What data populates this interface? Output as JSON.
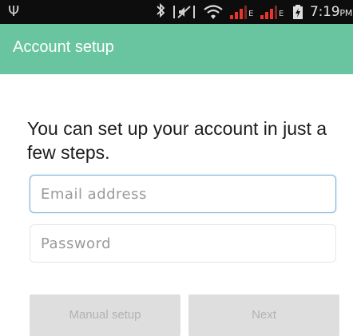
{
  "status_bar": {
    "usb_glyph": "Ψ",
    "bluetooth_glyph": "∦",
    "network_type_1": "E",
    "network_type_2": "E",
    "time": "7:19",
    "am_pm": "PM",
    "signal_color": "#e8362a",
    "icons": [
      "usb-icon",
      "bluetooth-icon",
      "mute-icon",
      "wifi-icon",
      "signal-icon",
      "signal-icon",
      "battery-icon"
    ]
  },
  "action_bar": {
    "title": "Account setup",
    "color": "#69c4a0"
  },
  "main": {
    "headline": "You can set up your account in just a few steps.",
    "email_placeholder": "Email address",
    "password_placeholder": "Password",
    "manual_setup_label": "Manual setup",
    "next_label": "Next"
  }
}
